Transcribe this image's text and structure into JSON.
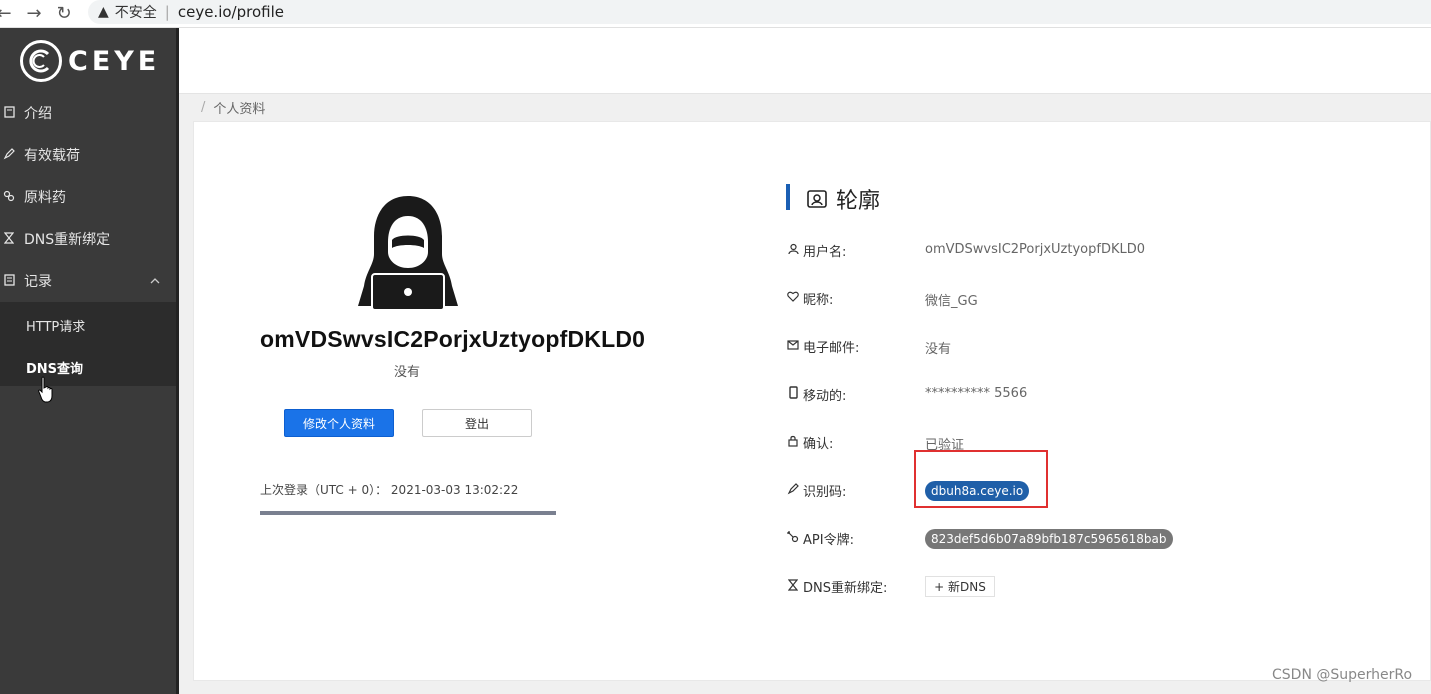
{
  "browser": {
    "back": "←",
    "forward": "→",
    "reload": "↻",
    "security_icon": "▲",
    "security_label": "不安全",
    "url": "ceye.io/profile"
  },
  "sidebar": {
    "logo_text": "CEYE",
    "items": [
      {
        "label": "介绍",
        "icon": "book-icon"
      },
      {
        "label": "有效载荷",
        "icon": "rocket-icon"
      },
      {
        "label": "原料药",
        "icon": "link-icon"
      },
      {
        "label": "DNS重新绑定",
        "icon": "hourglass-icon"
      },
      {
        "label": "记录",
        "icon": "list-icon"
      }
    ],
    "sub_items": [
      {
        "label": "HTTP请求"
      },
      {
        "label": "DNS查询"
      }
    ]
  },
  "breadcrumb": {
    "current": "个人资料"
  },
  "profile_card": {
    "username": "omVDSwvsIC2PorjxUztyopfDKLD0",
    "nickname": "没有",
    "edit_button": "修改个人资料",
    "logout_button": "登出",
    "last_login": "上次登录（UTC + 0）： 2021-03-03 13:02:22",
    "progress": 1.0
  },
  "profile_panel": {
    "title": "轮廓",
    "fields": {
      "username_label": "用户名:",
      "username_value": "omVDSwvsIC2PorjxUztyopfDKLD0",
      "nickname_label": "昵称:",
      "nickname_value": "微信_GG",
      "email_label": "电子邮件:",
      "email_value": "没有",
      "mobile_label": "移动的:",
      "mobile_value": "********** 5566",
      "confirm_label": "确认:",
      "confirm_value": "已验证",
      "identifier_label": "识别码:",
      "identifier_value": "dbuh8a.ceye.io",
      "api_label": "API令牌:",
      "api_value": "823def5d6b07a89bfb187c5965618bab",
      "dns_label": "DNS重新绑定:",
      "dns_button": "+ 新DNS"
    }
  },
  "watermark": "CSDN @SuperherRo",
  "colors": {
    "sidebar_bg": "#3a3a3a",
    "primary": "#1a73e8",
    "accent_bar": "#1a5fb4",
    "highlight": "#e03030"
  }
}
